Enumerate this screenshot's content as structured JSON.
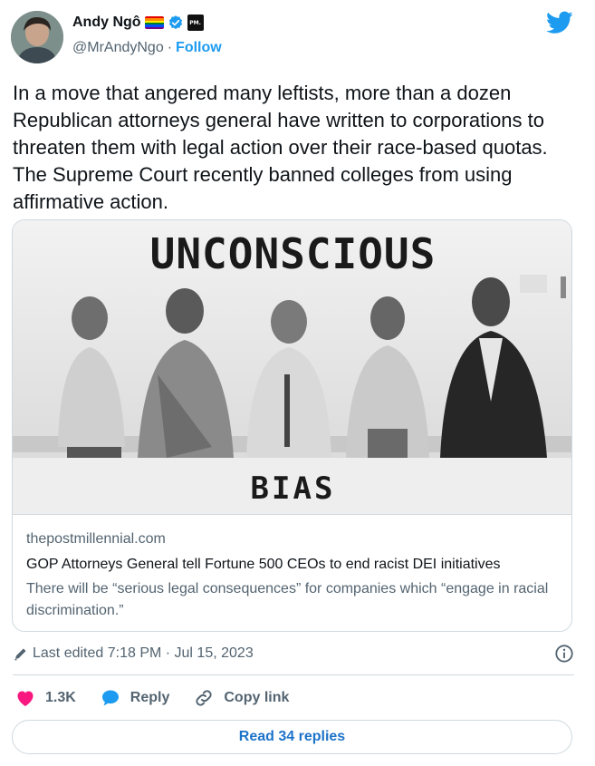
{
  "author": {
    "display_name": "Andy Ngô",
    "handle": "@MrAndyNgo",
    "separator": "·",
    "follow_label": "Follow",
    "badge_text": "PM."
  },
  "tweet": {
    "text": "In a move that angered many leftists, more than a dozen Republican attorneys general have written to corporations to threaten them with legal action over their race-based quotas. The Supreme Court recently banned colleges from using affirmative action."
  },
  "card": {
    "image_text_top": "UNCONSCIOUS",
    "image_text_bottom": "BIAS",
    "domain": "thepostmillennial.com",
    "title": "GOP Attorneys General tell Fortune 500 CEOs to end racist DEI initiatives",
    "description": "There will be “serious legal consequences” for companies which “engage in racial discrimination.”"
  },
  "meta": {
    "edited_text": "Last edited 7:18 PM · Jul 15, 2023"
  },
  "actions": {
    "like_count": "1.3K",
    "reply_label": "Reply",
    "copy_link_label": "Copy link"
  },
  "footer": {
    "read_replies_label": "Read 34 replies"
  },
  "colors": {
    "brand_blue": "#1d9bf0",
    "like_red": "#f91880",
    "text_primary": "#0f1419",
    "text_secondary": "#536471",
    "border": "#cfd9de"
  },
  "icons": [
    "rainbow-flag-icon",
    "verified-badge-icon",
    "twitter-bird-icon",
    "pencil-icon",
    "info-icon",
    "heart-icon",
    "reply-bubble-icon",
    "link-icon"
  ]
}
